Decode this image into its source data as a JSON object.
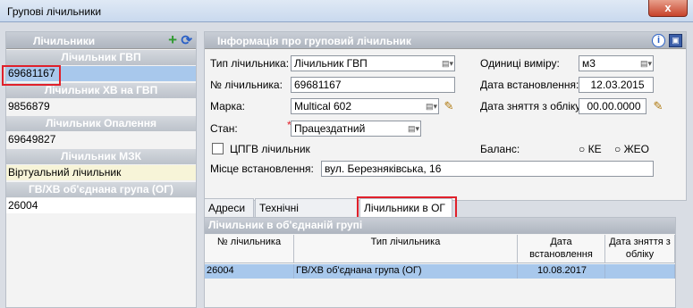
{
  "window": {
    "title": "Групові лічильники",
    "close_label": "x"
  },
  "left": {
    "header": "Лічильники",
    "groups": [
      {
        "title": "Лічильник ГВП",
        "value": "69681167"
      },
      {
        "title": "Лічильник ХВ на ГВП",
        "value": "9856879"
      },
      {
        "title": "Лічильник Опалення",
        "value": "69649827"
      },
      {
        "title": "Лічильник МЗК",
        "value": "Віртуальний лічильник"
      },
      {
        "title": "ГВ/ХВ об'єднана група (ОГ)",
        "value": "26004"
      }
    ]
  },
  "info": {
    "header": "Інформація про груповий лічильник",
    "type_label": "Тип лічильника:",
    "type_value": "Лічильник ГВП",
    "units_label": "Одиниці виміру:",
    "units_value": "м3",
    "number_label": "№ лічильника:",
    "number_value": "69681167",
    "install_label": "Дата встановлення:",
    "install_value": "12.03.2015",
    "brand_label": "Марка:",
    "brand_value": "Multical 602",
    "removal_label": "Дата зняття з обліку:",
    "removal_value": "00.00.0000",
    "state_label": "Стан:",
    "state_required": "*",
    "state_value": "Працездатний",
    "cpgv_label": "ЦПГВ лічильник",
    "balance_label": "Баланс:",
    "radio_ke": "КЕ",
    "radio_zheo": "ЖЕО",
    "location_label": "Місце встановлення:",
    "location_value": "вул. Березняківська, 16"
  },
  "tabs": [
    "Адреси",
    "Технічні параметри",
    "Лічильники в ОГ"
  ],
  "og": {
    "header": "Лічильник в об'єднаній групі",
    "columns": [
      "№ лічильника",
      "Тип лічильника",
      "Дата встановлення",
      "Дата зняття з обліку"
    ],
    "rows": [
      [
        "26004",
        "ГВ/ХВ об'єднана група (ОГ)",
        "10.08.2017",
        ""
      ]
    ]
  }
}
